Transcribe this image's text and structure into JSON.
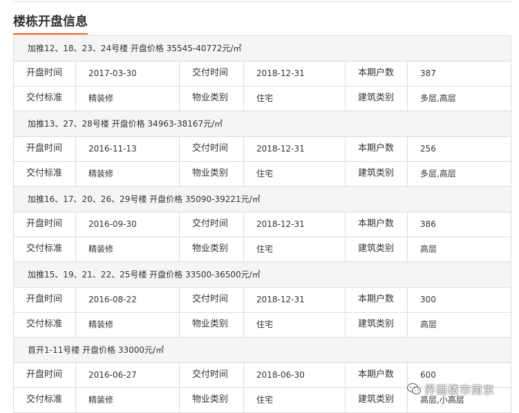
{
  "section": {
    "title": "楼栋开盘信息"
  },
  "labels": {
    "open_time": "开盘时间",
    "delivery_time": "交付时间",
    "units": "本期户数",
    "delivery_standard": "交付标准",
    "property_type": "物业类别",
    "building_type": "建筑类别"
  },
  "groups": [
    {
      "header": "加推12、18、23、24号楼 开盘价格 35545-40772元/㎡",
      "open_time": "2017-03-30",
      "delivery_time": "2018-12-31",
      "units": "387",
      "delivery_standard": "精装修",
      "property_type": "住宅",
      "building_type": "多层,高层"
    },
    {
      "header": "加推13、27、28号楼 开盘价格 34963-38167元/㎡",
      "open_time": "2016-11-13",
      "delivery_time": "2018-12-31",
      "units": "256",
      "delivery_standard": "精装修",
      "property_type": "住宅",
      "building_type": "多层,高层"
    },
    {
      "header": "加推16、17、20、26、29号楼 开盘价格 35090-39221元/㎡",
      "open_time": "2016-09-30",
      "delivery_time": "2018-12-31",
      "units": "386",
      "delivery_standard": "精装修",
      "property_type": "住宅",
      "building_type": "高层"
    },
    {
      "header": "加推15、19、21、22、25号楼 开盘价格 33500-36500元/㎡",
      "open_time": "2016-08-22",
      "delivery_time": "2018-12-31",
      "units": "300",
      "delivery_standard": "精装修",
      "property_type": "住宅",
      "building_type": "高层"
    },
    {
      "header": "首开1-11号楼 开盘价格 33000元/㎡",
      "open_time": "2016-06-27",
      "delivery_time": "2018-06-30",
      "units": "600",
      "delivery_standard": "精装修",
      "property_type": "住宅",
      "building_type": "高层,小高层"
    }
  ],
  "watermark": {
    "text": "界面楼市南京",
    "icon": "wechat-icon"
  }
}
